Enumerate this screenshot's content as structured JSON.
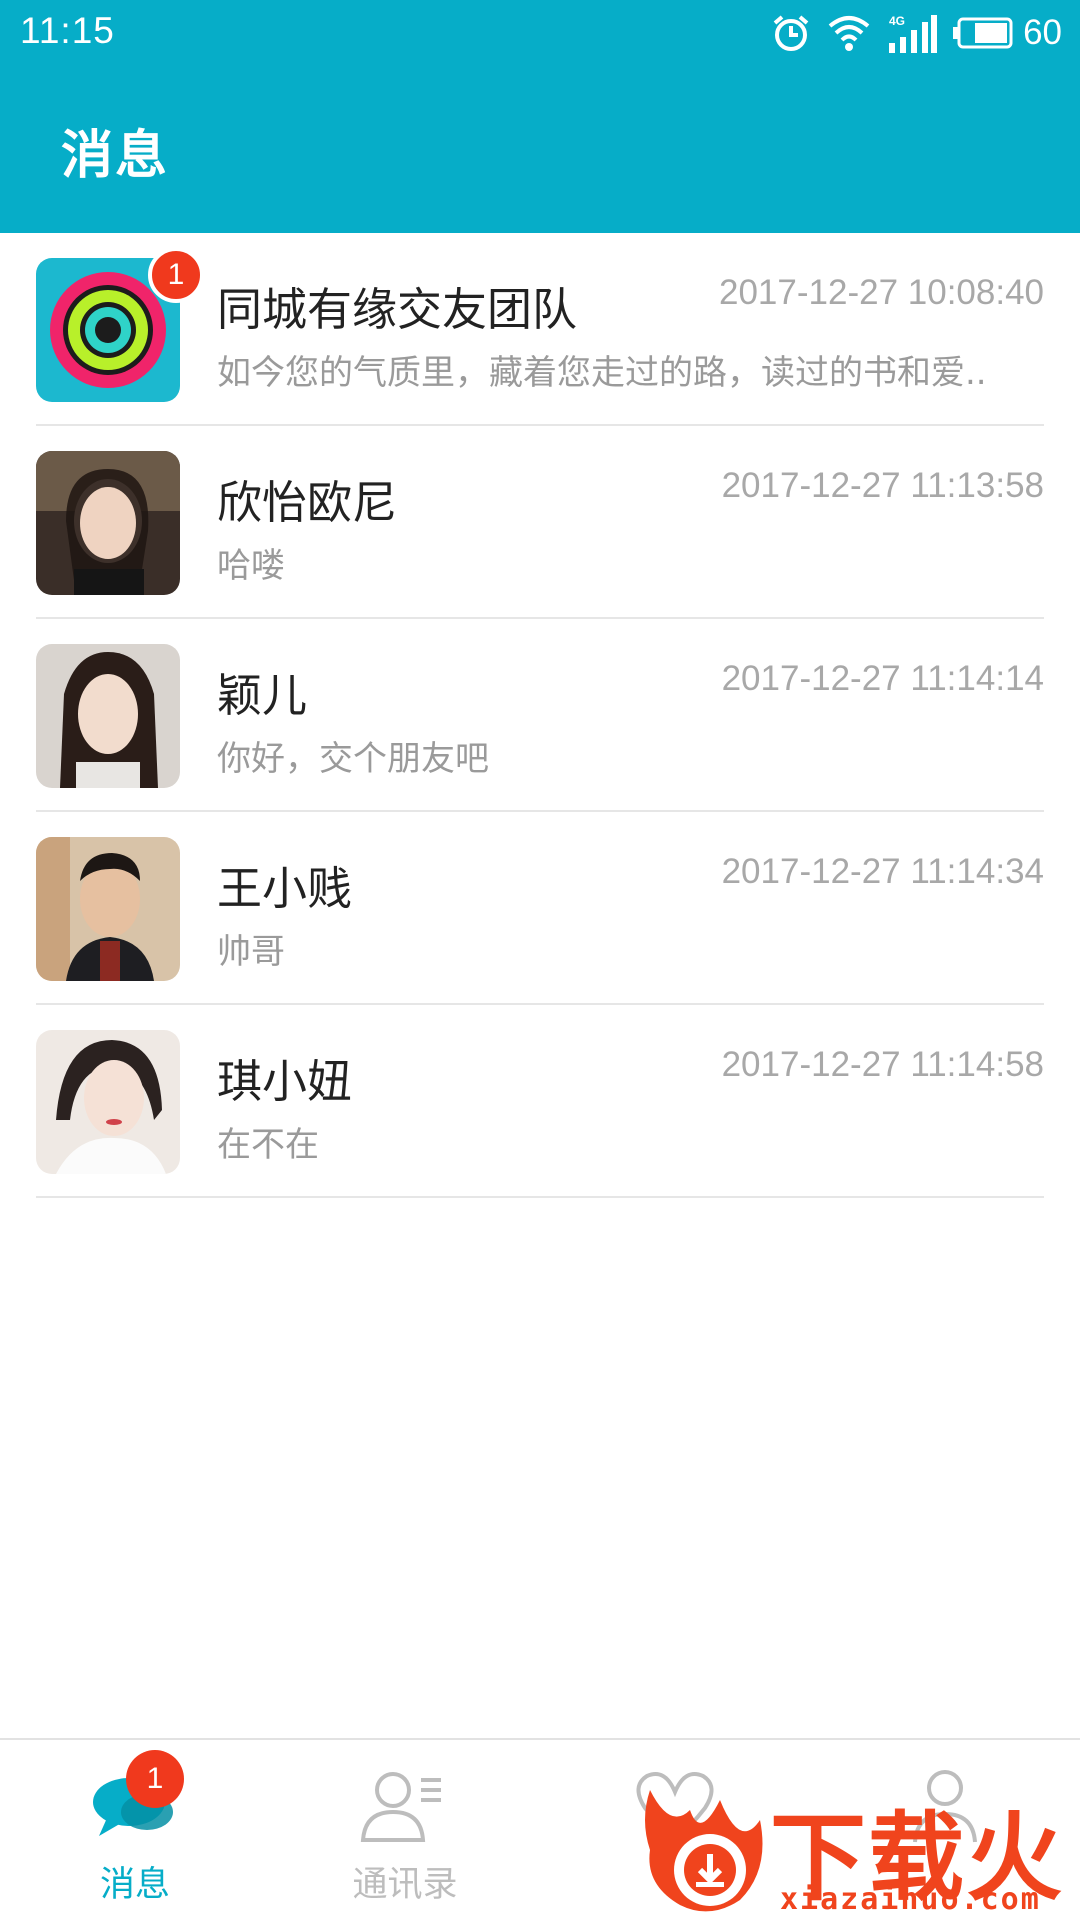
{
  "status_bar": {
    "time": "11:15",
    "network": "4G",
    "battery_level": "60",
    "icons": [
      "alarm-icon",
      "wifi-icon",
      "signal-icon",
      "battery-icon"
    ]
  },
  "header": {
    "title": "消息",
    "background_color": "#06adc8"
  },
  "messages": [
    {
      "name": "同城有缘交友团队",
      "time": "2017-12-27 10:08:40",
      "preview": "如今您的气质里，藏着您走过的路，读过的书和爱..",
      "unread": "1"
    },
    {
      "name": "欣怡欧尼",
      "time": "2017-12-27 11:13:58",
      "preview": "哈喽"
    },
    {
      "name": "颖儿",
      "time": "2017-12-27 11:14:14",
      "preview": "你好，交个朋友吧"
    },
    {
      "name": "王小贱",
      "time": "2017-12-27 11:14:34",
      "preview": "帅哥"
    },
    {
      "name": "琪小妞",
      "time": "2017-12-27 11:14:58",
      "preview": "在不在"
    }
  ],
  "bottom_nav": {
    "tabs": [
      {
        "label": "消息",
        "icon": "chat-bubble-icon",
        "badge": "1",
        "active": true
      },
      {
        "label": "通讯录",
        "icon": "contacts-icon"
      },
      {
        "label": "",
        "icon": "heart-icon"
      },
      {
        "label": "",
        "icon": "profile-icon"
      }
    ],
    "active_color": "#06adc8",
    "inactive_color": "#bdbdbd"
  },
  "watermark": {
    "brand": "下载火",
    "url": "xiazaihuo.com",
    "color": "#f0441d"
  },
  "colors": {
    "badge": "#f0391d",
    "divider": "#e6e6e6"
  }
}
